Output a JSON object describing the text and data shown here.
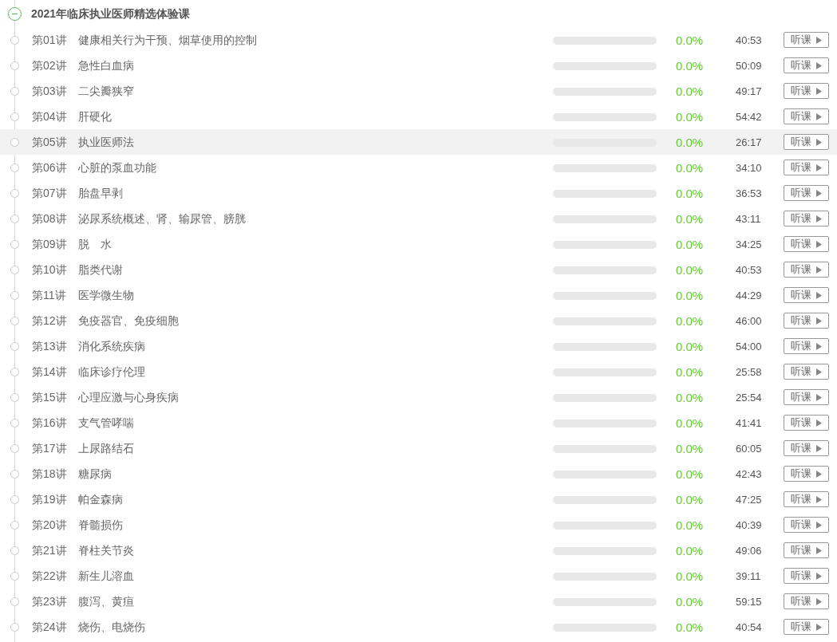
{
  "course": {
    "title": "2021年临床执业医师精选体验课",
    "expanded": true
  },
  "lectures": [
    {
      "number": "第01讲",
      "title": "健康相关行为干预、烟草使用的控制",
      "level": 0,
      "percent": "0.0%",
      "duration": "40:53",
      "button": "听课",
      "selected": false
    },
    {
      "number": "第02讲",
      "title": "急性白血病",
      "level": 0,
      "percent": "0.0%",
      "duration": "50:09",
      "button": "听课",
      "selected": false
    },
    {
      "number": "第03讲",
      "title": "二尖瓣狭窄",
      "level": 0,
      "percent": "0.0%",
      "duration": "49:17",
      "button": "听课",
      "selected": false
    },
    {
      "number": "第04讲",
      "title": "肝硬化",
      "level": 0,
      "percent": "0.0%",
      "duration": "54:42",
      "button": "听课",
      "selected": false
    },
    {
      "number": "第05讲",
      "title": "执业医师法",
      "level": 0,
      "percent": "0.0%",
      "duration": "26:17",
      "button": "听课",
      "selected": true
    },
    {
      "number": "第06讲",
      "title": "心脏的泵血功能",
      "level": 0,
      "percent": "0.0%",
      "duration": "34:10",
      "button": "听课",
      "selected": false
    },
    {
      "number": "第07讲",
      "title": "胎盘早剥",
      "level": 0,
      "percent": "0.0%",
      "duration": "36:53",
      "button": "听课",
      "selected": false
    },
    {
      "number": "第08讲",
      "title": "泌尿系统概述、肾、输尿管、膀胱",
      "level": 0,
      "percent": "0.0%",
      "duration": "43:11",
      "button": "听课",
      "selected": false
    },
    {
      "number": "第09讲",
      "title": "脱　水",
      "level": 0,
      "percent": "0.0%",
      "duration": "34:25",
      "button": "听课",
      "selected": false
    },
    {
      "number": "第10讲",
      "title": "脂类代谢",
      "level": 0,
      "percent": "0.0%",
      "duration": "40:53",
      "button": "听课",
      "selected": false
    },
    {
      "number": "第11讲",
      "title": "医学微生物",
      "level": 0,
      "percent": "0.0%",
      "duration": "44:29",
      "button": "听课",
      "selected": false
    },
    {
      "number": "第12讲",
      "title": "免疫器官、免疫细胞",
      "level": 0,
      "percent": "0.0%",
      "duration": "46:00",
      "button": "听课",
      "selected": false
    },
    {
      "number": "第13讲",
      "title": "消化系统疾病",
      "level": 0,
      "percent": "0.0%",
      "duration": "54:00",
      "button": "听课",
      "selected": false
    },
    {
      "number": "第14讲",
      "title": "临床诊疗伦理",
      "level": 0,
      "percent": "0.0%",
      "duration": "25:58",
      "button": "听课",
      "selected": false
    },
    {
      "number": "第15讲",
      "title": "心理应激与心身疾病",
      "level": 0,
      "percent": "0.0%",
      "duration": "25:54",
      "button": "听课",
      "selected": false
    },
    {
      "number": "第16讲",
      "title": "支气管哮喘",
      "level": 0,
      "percent": "0.0%",
      "duration": "41:41",
      "button": "听课",
      "selected": false
    },
    {
      "number": "第17讲",
      "title": "上尿路结石",
      "level": 0,
      "percent": "0.0%",
      "duration": "60:05",
      "button": "听课",
      "selected": false
    },
    {
      "number": "第18讲",
      "title": "糖尿病",
      "level": 0,
      "percent": "0.0%",
      "duration": "42:43",
      "button": "听课",
      "selected": false
    },
    {
      "number": "第19讲",
      "title": "帕金森病",
      "level": 0,
      "percent": "0.0%",
      "duration": "47:25",
      "button": "听课",
      "selected": false
    },
    {
      "number": "第20讲",
      "title": "脊髓损伤",
      "level": 0,
      "percent": "0.0%",
      "duration": "40:39",
      "button": "听课",
      "selected": false
    },
    {
      "number": "第21讲",
      "title": "脊柱关节炎",
      "level": 0,
      "percent": "0.0%",
      "duration": "49:06",
      "button": "听课",
      "selected": false
    },
    {
      "number": "第22讲",
      "title": "新生儿溶血",
      "level": 0,
      "percent": "0.0%",
      "duration": "39:11",
      "button": "听课",
      "selected": false
    },
    {
      "number": "第23讲",
      "title": "腹泻、黄疸",
      "level": 0,
      "percent": "0.0%",
      "duration": "59:15",
      "button": "听课",
      "selected": false
    },
    {
      "number": "第24讲",
      "title": "烧伤、电烧伤",
      "level": 0,
      "percent": "0.0%",
      "duration": "40:54",
      "button": "听课",
      "selected": false
    }
  ]
}
